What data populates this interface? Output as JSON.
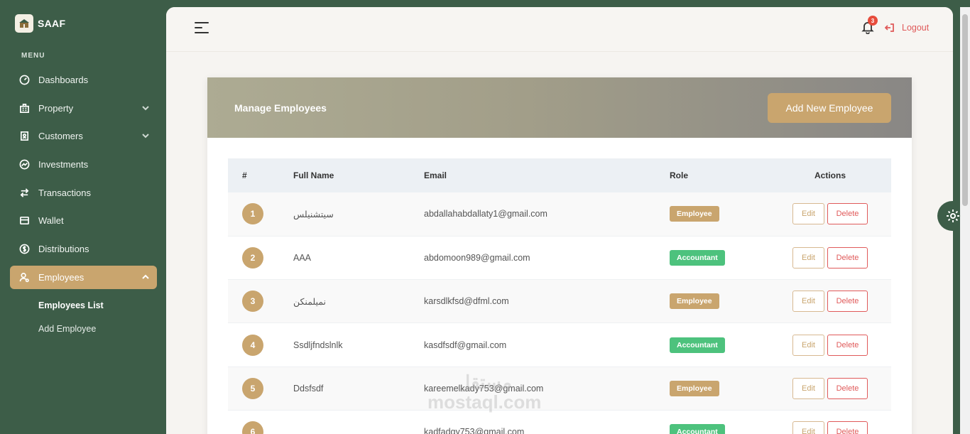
{
  "brand": {
    "name": "SAAF",
    "logo_icon": "brand-logo-icon"
  },
  "sidebar": {
    "menu_label": "MENU",
    "items": [
      {
        "label": "Dashboards",
        "icon": "dashboard-icon"
      },
      {
        "label": "Property",
        "icon": "building-icon",
        "expandable": true
      },
      {
        "label": "Customers",
        "icon": "contacts-icon",
        "expandable": true
      },
      {
        "label": "Investments",
        "icon": "chart-icon"
      },
      {
        "label": "Transactions",
        "icon": "swap-icon"
      },
      {
        "label": "Wallet",
        "icon": "wallet-icon"
      },
      {
        "label": "Distributions",
        "icon": "dollar-icon"
      },
      {
        "label": "Employees",
        "icon": "user-gear-icon",
        "active": true,
        "expanded": true
      }
    ],
    "sub_items": [
      {
        "label": "Employees List",
        "active": true
      },
      {
        "label": "Add Employee"
      }
    ]
  },
  "topbar": {
    "notification_count": "3",
    "logout_label": "Logout"
  },
  "card": {
    "title": "Manage Employees",
    "add_button": "Add New Employee"
  },
  "table": {
    "headers": [
      "#",
      "Full Name",
      "Email",
      "Role",
      "Actions"
    ],
    "edit_label": "Edit",
    "delete_label": "Delete",
    "rows": [
      {
        "num": "1",
        "name": "سيتشنيلس",
        "email": "abdallahabdallaty1@gmail.com",
        "role": "Employee"
      },
      {
        "num": "2",
        "name": "AAA",
        "email": "abdomoon989@gmail.com",
        "role": "Accountant"
      },
      {
        "num": "3",
        "name": "نميلمنكن",
        "email": "karsdlkfsd@dfml.com",
        "role": "Employee"
      },
      {
        "num": "4",
        "name": "Ssdljfndslnlk",
        "email": "kasdfsdf@gmail.com",
        "role": "Accountant"
      },
      {
        "num": "5",
        "name": "Ddsfsdf",
        "email": "kareemelkady753@gmail.com",
        "role": "Employee"
      },
      {
        "num": "6",
        "name": "",
        "email": "kadfadgy753@gmail.com",
        "role": "Accountant"
      }
    ]
  },
  "watermark": {
    "arabic": "مستقل",
    "latin": "mostaql.com"
  },
  "colors": {
    "sidebar": "#3d5d48",
    "accent": "#c9a56e",
    "accountant": "#4dc27d",
    "danger": "#e05a5a"
  }
}
